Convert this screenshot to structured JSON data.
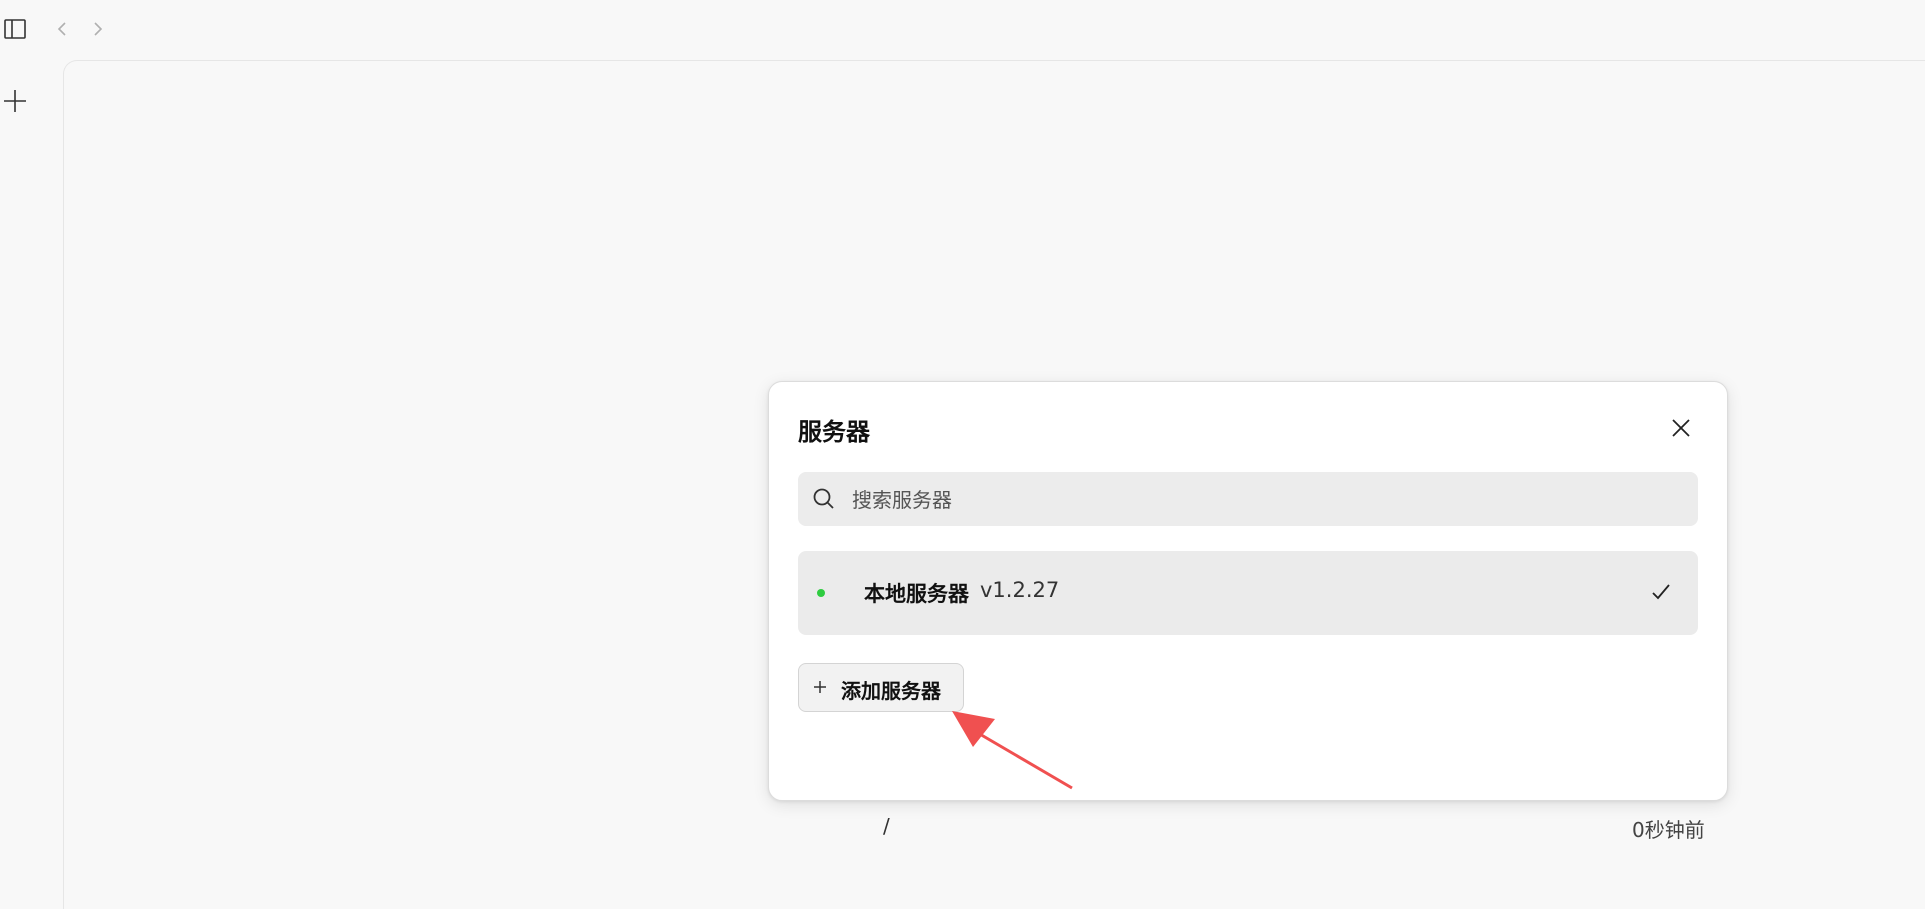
{
  "dialog": {
    "title": "服务器",
    "search": {
      "placeholder": "搜索服务器",
      "value": ""
    },
    "servers": [
      {
        "name": "本地服务器",
        "version": "v1.2.27",
        "status_color": "#2ecc40",
        "selected": true
      }
    ],
    "add_button_label": "添加服务器"
  },
  "background": {
    "path": "/",
    "time": "0秒钟前"
  },
  "icons": {
    "sidebar_toggle": "sidebar-toggle-icon",
    "back": "chevron-left-icon",
    "forward": "chevron-right-icon",
    "new": "plus-icon",
    "close": "close-icon",
    "search": "search-icon",
    "check": "check-icon"
  },
  "colors": {
    "accent_arrow": "#f05050",
    "status_online": "#2ecc40"
  }
}
